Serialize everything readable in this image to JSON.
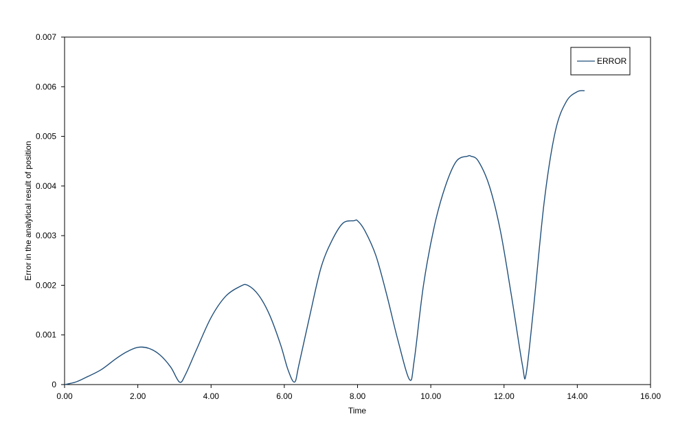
{
  "chart_data": {
    "type": "line",
    "title": "",
    "xlabel": "Time",
    "ylabel": "Error in the analytical result of position",
    "xlim": [
      0,
      16
    ],
    "ylim": [
      0,
      0.007
    ],
    "x_ticks": [
      "0.00",
      "2.00",
      "4.00",
      "6.00",
      "8.00",
      "10.00",
      "12.00",
      "14.00",
      "16.00"
    ],
    "y_ticks": [
      "0",
      "0.001",
      "0.002",
      "0.003",
      "0.004",
      "0.005",
      "0.006",
      "0.007"
    ],
    "grid": false,
    "legend_position": "top-right",
    "series": [
      {
        "name": "ERROR",
        "color": "#1f4e79",
        "x": [
          0.0,
          0.3,
          0.6,
          1.0,
          1.4,
          1.7,
          2.0,
          2.3,
          2.6,
          2.9,
          3.14,
          3.3,
          3.6,
          4.0,
          4.4,
          4.8,
          5.0,
          5.3,
          5.6,
          5.9,
          6.1,
          6.28,
          6.4,
          6.7,
          7.0,
          7.3,
          7.6,
          7.9,
          8.0,
          8.2,
          8.5,
          8.8,
          9.1,
          9.42,
          9.55,
          9.8,
          10.1,
          10.4,
          10.7,
          11.0,
          11.1,
          11.3,
          11.6,
          11.9,
          12.2,
          12.5,
          12.6,
          12.8,
          13.1,
          13.4,
          13.7,
          14.0,
          14.2
        ],
        "y": [
          0.0,
          5e-05,
          0.00015,
          0.0003,
          0.00052,
          0.00066,
          0.00075,
          0.00073,
          0.0006,
          0.00035,
          5e-05,
          0.0002,
          0.0007,
          0.00135,
          0.00178,
          0.00198,
          0.002,
          0.0018,
          0.0014,
          0.0008,
          0.0003,
          5e-05,
          0.0004,
          0.0014,
          0.00235,
          0.0029,
          0.00325,
          0.0033,
          0.0033,
          0.0031,
          0.0026,
          0.0018,
          0.0009,
          0.0001,
          0.0005,
          0.002,
          0.0032,
          0.004,
          0.0045,
          0.0046,
          0.0046,
          0.0045,
          0.004,
          0.0031,
          0.0018,
          0.0004,
          0.0002,
          0.0015,
          0.0037,
          0.0051,
          0.0057,
          0.0059,
          0.00592
        ]
      }
    ]
  }
}
